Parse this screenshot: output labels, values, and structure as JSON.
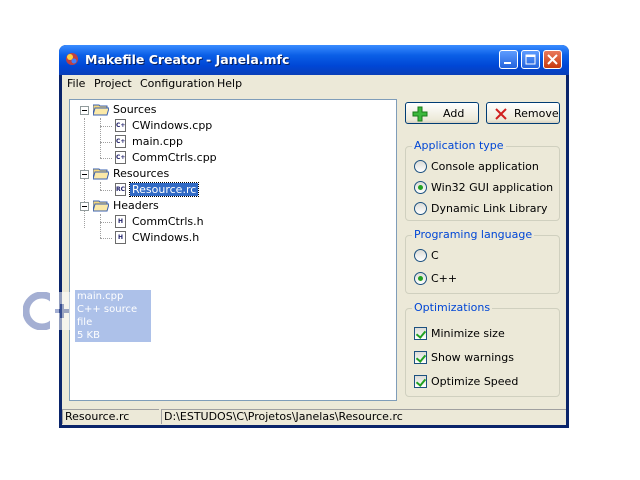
{
  "window": {
    "title": "Makefile Creator - Janela.mfc"
  },
  "menu": [
    "File",
    "Project",
    "Configuration",
    "Help"
  ],
  "tree": {
    "nodes": [
      {
        "label": "Sources",
        "type": "folder",
        "expanded": true
      },
      {
        "label": "CWindows.cpp",
        "type": "file",
        "icon": "cpp-file-icon"
      },
      {
        "label": "main.cpp",
        "type": "file",
        "icon": "cpp-file-icon"
      },
      {
        "label": "CommCtrls.cpp",
        "type": "file",
        "icon": "cpp-file-icon"
      },
      {
        "label": "Resources",
        "type": "folder",
        "expanded": true
      },
      {
        "label": "Resource.rc",
        "type": "file",
        "icon": "rc-file-icon",
        "selected": true
      },
      {
        "label": "Headers",
        "type": "folder",
        "expanded": true
      },
      {
        "label": "CommCtrls.h",
        "type": "file",
        "icon": "h-file-icon"
      },
      {
        "label": "CWindows.h",
        "type": "file",
        "icon": "h-file-icon"
      }
    ]
  },
  "drag_tooltip": {
    "name": "main.cpp",
    "type": "C++ source file",
    "size": "5 KB"
  },
  "buttons": {
    "add": "Add",
    "remove": "Remove"
  },
  "application_type": {
    "title": "Application type",
    "options": [
      "Console application",
      "Win32 GUI application",
      "Dynamic Link Library"
    ],
    "selected": "Win32 GUI application"
  },
  "language": {
    "title": "Programing language",
    "options": [
      "C",
      "C++"
    ],
    "selected": "C++"
  },
  "optimizations": {
    "title": "Optimizations",
    "options": [
      {
        "label": "Minimize size",
        "checked": true
      },
      {
        "label": "Show warnings",
        "checked": true
      },
      {
        "label": "Optimize Speed",
        "checked": true
      }
    ]
  },
  "status": {
    "file": "Resource.rc",
    "path": "D:\\ESTUDOS\\C\\Projetos\\Janelas\\Resource.rc"
  },
  "colors": {
    "titlebar": "#0a5ee6",
    "face": "#ece9d8",
    "group_title": "#0046d5",
    "selection": "#316ac5",
    "check_mark": "#21a121"
  }
}
